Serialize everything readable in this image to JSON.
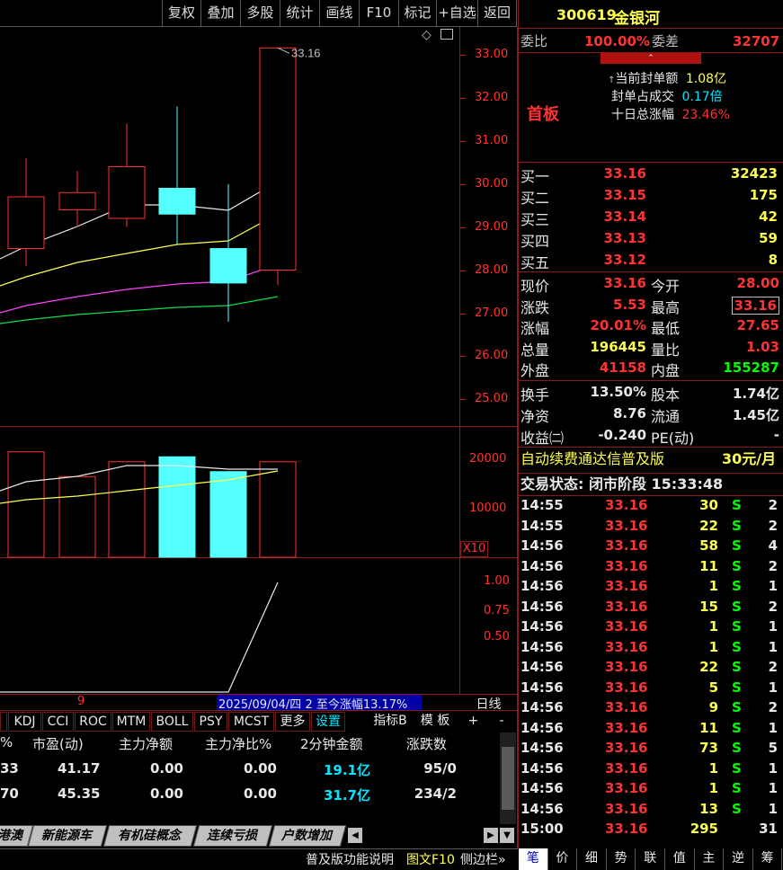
{
  "toolbar": {
    "items": [
      "复权",
      "叠加",
      "多股",
      "统计",
      "画线",
      "F10",
      "标记",
      "+自选",
      "返回"
    ]
  },
  "stock": {
    "code": "300619",
    "name": "金银河"
  },
  "order": {
    "ratio_label": "委比",
    "ratio_value": "100.00%",
    "diff_label": "委差",
    "diff_value": "32707"
  },
  "seal": {
    "board": "首板",
    "amount_label": "当前封单额",
    "amount_value": "1.08亿",
    "ratio_label": "封单占成交",
    "ratio_value": "0.17倍",
    "tenday_label": "十日总涨幅",
    "tenday_value": "23.46%"
  },
  "bids": [
    {
      "label": "买一",
      "price": "33.16",
      "vol": "32423"
    },
    {
      "label": "买二",
      "price": "33.15",
      "vol": "175"
    },
    {
      "label": "买三",
      "price": "33.14",
      "vol": "42"
    },
    {
      "label": "买四",
      "price": "33.13",
      "vol": "59"
    },
    {
      "label": "买五",
      "price": "33.12",
      "vol": "8"
    }
  ],
  "quote": [
    {
      "l1": "现价",
      "v1": "33.16",
      "l2": "今开",
      "v2": "28.00"
    },
    {
      "l1": "涨跌",
      "v1": "5.53",
      "l2": "最高",
      "v2": "33.16"
    },
    {
      "l1": "涨幅",
      "v1": "20.01%",
      "l2": "最低",
      "v2": "27.65"
    },
    {
      "l1": "总量",
      "v1": "196445",
      "l2": "量比",
      "v2": "1.03"
    },
    {
      "l1": "外盘",
      "v1": "41158",
      "l2": "内盘",
      "v2": "155287"
    }
  ],
  "fund": [
    {
      "l1": "换手",
      "v1": "13.50%",
      "l2": "股本",
      "v2": "1.74亿"
    },
    {
      "l1": "净资",
      "v1": "8.76",
      "l2": "流通",
      "v2": "1.45亿"
    },
    {
      "l1": "收益㈡",
      "v1": "-0.240",
      "l2": "PE(动)",
      "v2": "-"
    }
  ],
  "ad": {
    "text": "自动续费通达信普及版",
    "price": "30元/月"
  },
  "status": {
    "text": "交易状态: 闭市阶段 15:33:48"
  },
  "ticks": [
    {
      "t": "14:55",
      "p": "33.16",
      "v": "30",
      "s": "S",
      "n": "2"
    },
    {
      "t": "14:55",
      "p": "33.16",
      "v": "22",
      "s": "S",
      "n": "2"
    },
    {
      "t": "14:56",
      "p": "33.16",
      "v": "58",
      "s": "S",
      "n": "4"
    },
    {
      "t": "14:56",
      "p": "33.16",
      "v": "11",
      "s": "S",
      "n": "2"
    },
    {
      "t": "14:56",
      "p": "33.16",
      "v": "1",
      "s": "S",
      "n": "1"
    },
    {
      "t": "14:56",
      "p": "33.16",
      "v": "15",
      "s": "S",
      "n": "2"
    },
    {
      "t": "14:56",
      "p": "33.16",
      "v": "1",
      "s": "S",
      "n": "1"
    },
    {
      "t": "14:56",
      "p": "33.16",
      "v": "1",
      "s": "S",
      "n": "1"
    },
    {
      "t": "14:56",
      "p": "33.16",
      "v": "22",
      "s": "S",
      "n": "2"
    },
    {
      "t": "14:56",
      "p": "33.16",
      "v": "5",
      "s": "S",
      "n": "1"
    },
    {
      "t": "14:56",
      "p": "33.16",
      "v": "9",
      "s": "S",
      "n": "2"
    },
    {
      "t": "14:56",
      "p": "33.16",
      "v": "11",
      "s": "S",
      "n": "1"
    },
    {
      "t": "14:56",
      "p": "33.16",
      "v": "73",
      "s": "S",
      "n": "5"
    },
    {
      "t": "14:56",
      "p": "33.16",
      "v": "1",
      "s": "S",
      "n": "1"
    },
    {
      "t": "14:56",
      "p": "33.16",
      "v": "1",
      "s": "S",
      "n": "1"
    },
    {
      "t": "14:56",
      "p": "33.16",
      "v": "13",
      "s": "S",
      "n": "1"
    },
    {
      "t": "15:00",
      "p": "33.16",
      "v": "295",
      "s": "",
      "n": "31"
    }
  ],
  "chart": {
    "price_ticks": [
      "33.00",
      "32.00",
      "31.00",
      "30.00",
      "29.00",
      "28.00",
      "27.00",
      "26.00",
      "25.00"
    ],
    "high_label": "33.16",
    "vol_ticks": [
      "20000",
      "10000"
    ],
    "vol_unit": "X10",
    "ind_ticks": [
      "1.00",
      "0.75",
      "0.50"
    ],
    "period": "日线",
    "range_left": "9",
    "range_text": "2025/09/04/四 2 至今涨幅13.17%"
  },
  "chart_data": {
    "type": "candlestick",
    "candles": [
      {
        "o": 28.5,
        "c": 29.7,
        "h": 30.6,
        "l": 28.1
      },
      {
        "o": 29.4,
        "c": 29.8,
        "h": 30.3,
        "l": 29.0
      },
      {
        "o": 29.2,
        "c": 30.4,
        "h": 31.4,
        "l": 29.0
      },
      {
        "o": 29.9,
        "c": 29.3,
        "h": 31.8,
        "l": 28.6
      },
      {
        "o": 28.5,
        "c": 27.7,
        "h": 30.0,
        "l": 26.8
      },
      {
        "o": 28.0,
        "c": 33.16,
        "h": 33.16,
        "l": 27.65
      }
    ],
    "volumes": [
      21500,
      16500,
      19500,
      20500,
      17500,
      19500
    ],
    "ylim": [
      24.5,
      33.5
    ]
  },
  "indicators": {
    "tabs": [
      "KDJ",
      "CCI",
      "ROC",
      "MTM",
      "BOLL",
      "PSY",
      "MCST",
      "更多",
      "设置"
    ],
    "right": [
      "指标B",
      "模 板",
      "+",
      "-"
    ]
  },
  "table": {
    "headers": [
      "%",
      "市盈(动)",
      "主力净额",
      "主力净比%",
      "2分钟金额",
      "涨跌数"
    ],
    "rows": [
      [
        "33",
        "41.17",
        "0.00",
        "0.00",
        "19.1亿",
        "95/0"
      ],
      [
        "70",
        "45.35",
        "0.00",
        "0.00",
        "31.7亿",
        "234/2"
      ]
    ]
  },
  "sector_tabs": [
    "港澳",
    "新能源车",
    "有机硅概念",
    "连续亏损",
    "户数增加"
  ],
  "status_bar": {
    "help": "普及版功能说明",
    "f10": "图文F10",
    "side": "侧边栏»"
  },
  "right_tabs": [
    "笔",
    "价",
    "细",
    "势",
    "联",
    "值",
    "主",
    "逆",
    "筹"
  ]
}
